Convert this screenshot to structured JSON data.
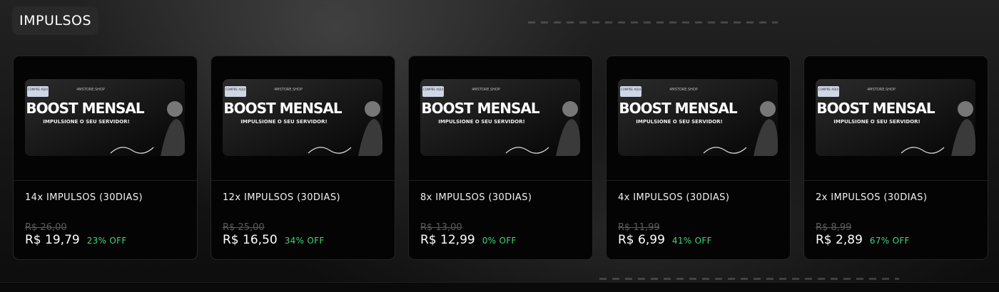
{
  "section": {
    "title": "IMPULSOS"
  },
  "banner": {
    "store": "4MSTORE.SHOP",
    "headline": "BOOST MENSAL",
    "tagline": "IMPULSIONE O SEU SERVIDOR!",
    "badge": "COMPRE AQUI"
  },
  "colors": {
    "accent_off": "#3fd67a",
    "card_bg": "#040404",
    "card_border": "#262626"
  },
  "products": [
    {
      "title": "14x IMPULSOS (30DIAS)",
      "old_price": "R$ 26,00",
      "price": "R$ 19,79",
      "off": "23% OFF"
    },
    {
      "title": "12x IMPULSOS (30DIAS)",
      "old_price": "R$ 25,00",
      "price": "R$ 16,50",
      "off": "34% OFF"
    },
    {
      "title": "8x IMPULSOS (30DIAS)",
      "old_price": "R$ 13,00",
      "price": "R$ 12,99",
      "off": "0% OFF"
    },
    {
      "title": "4x IMPULSOS (30DIAS)",
      "old_price": "R$ 11,99",
      "price": "R$ 6,99",
      "off": "41% OFF"
    },
    {
      "title": "2x IMPULSOS (30DIAS)",
      "old_price": "R$ 8,99",
      "price": "R$ 2,89",
      "off": "67% OFF"
    }
  ]
}
